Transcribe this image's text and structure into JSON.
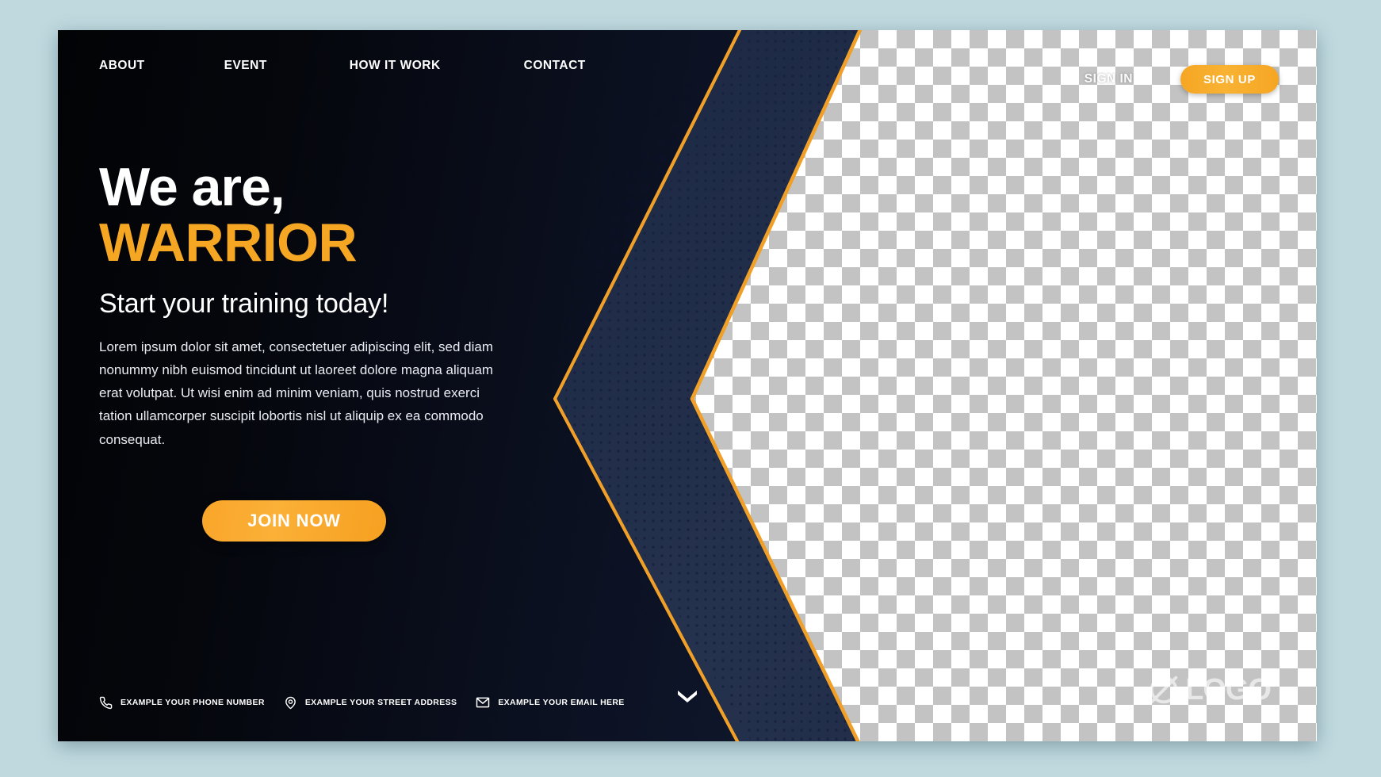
{
  "page": {
    "title": "We are, WARRIOR — Fitness Landing Page",
    "background_color": "#bfd9df",
    "canvas_background": "#0a0d16",
    "accent_color": "#f5a623",
    "accent_color_light": "#fbb037",
    "panel_blue": "#24324f",
    "text_color": "#ffffff"
  },
  "nav": {
    "links": [
      {
        "label": "ABOUT",
        "name": "nav-link-about"
      },
      {
        "label": "EVENT",
        "name": "nav-link-event"
      },
      {
        "label": "HOW IT WORK",
        "name": "nav-link-how-it-work"
      },
      {
        "label": "CONTACT",
        "name": "nav-link-contact"
      }
    ],
    "sign_in_label": "SIGN IN",
    "sign_up_label": "SIGN UP"
  },
  "hero": {
    "heading_line1": "We are,",
    "heading_line2": "WARRIOR",
    "subheading": "Start your training today!",
    "body": "Lorem ipsum dolor sit amet, consectetuer adipiscing elit, sed diam nonummy nibh euismod tincidunt ut laoreet dolore magna aliquam erat volutpat. Ut wisi enim ad minim veniam, quis nostrud exerci tation ullamcorper suscipit lobortis nisl ut aliquip ex ea commodo consequat.",
    "cta_label": "JOIN NOW"
  },
  "footer": {
    "contacts": [
      {
        "icon": "phone-icon",
        "label": "EXAMPLE YOUR PHONE NUMBER",
        "name": "contact-phone"
      },
      {
        "icon": "location-pin-icon",
        "label": "EXAMPLE YOUR STREET ADDRESS",
        "name": "contact-address"
      },
      {
        "icon": "envelope-icon",
        "label": "EXAMPLE YOUR EMAIL HERE",
        "name": "contact-email"
      }
    ],
    "scroll_icon": "chevron-down-icon"
  },
  "watermark": {
    "logo_text": "LOGO",
    "logo_icon": "circle-slash-logo-icon"
  },
  "decor": {
    "image_placeholder": "transparent-checkerboard",
    "halftone": "dot-halftone-pattern",
    "chevron_outer": "orange-outlined-chevron",
    "chevron_inner": "orange-outlined-chevron"
  }
}
